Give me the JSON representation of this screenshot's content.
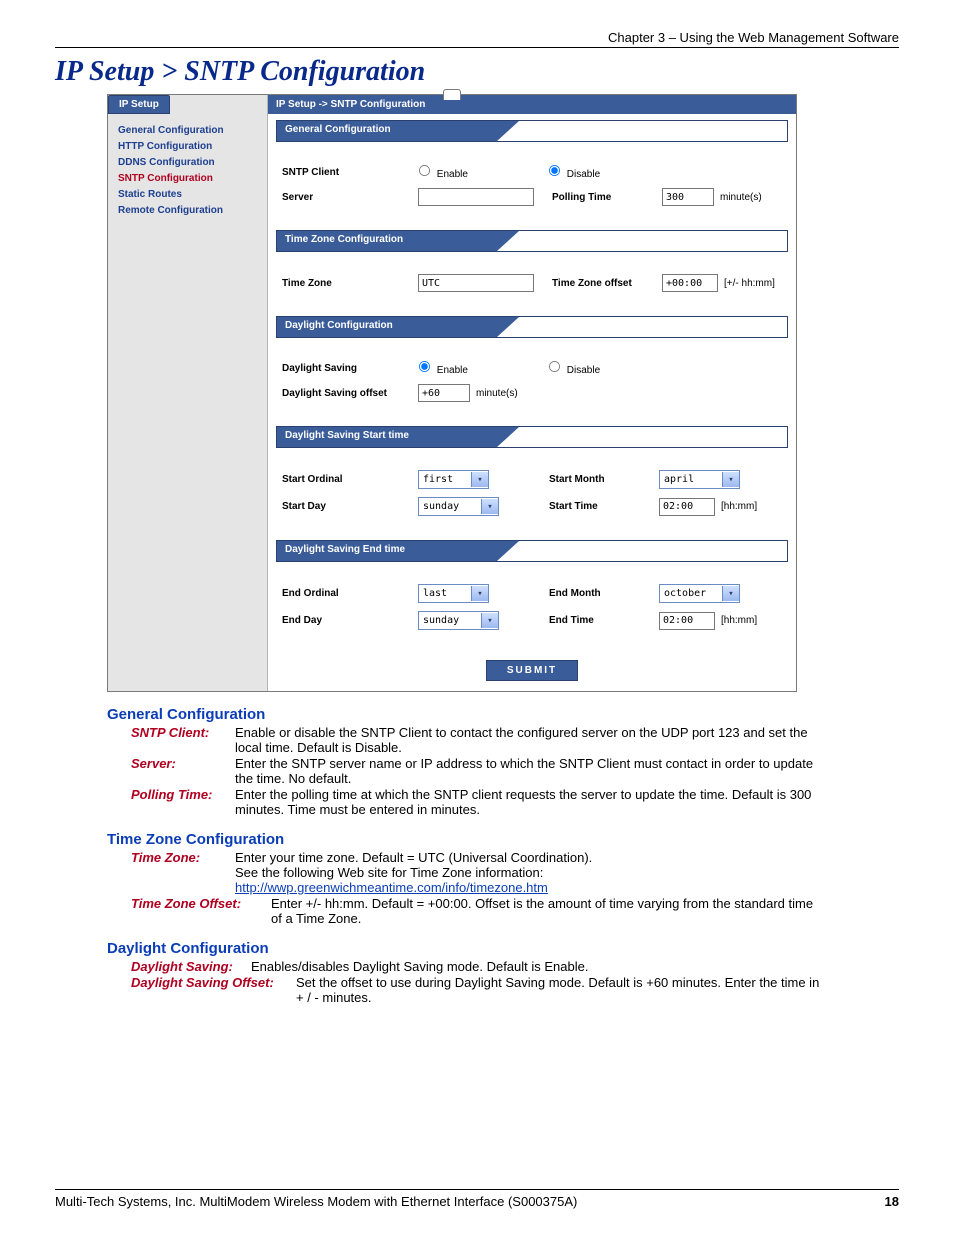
{
  "chapter_head": "Chapter 3 – Using the Web Management Software",
  "page_title": "IP Setup > SNTP Configuration",
  "sidebar": {
    "tab": "IP Setup",
    "items": [
      {
        "label": "General Configuration",
        "active": false
      },
      {
        "label": "HTTP Configuration",
        "active": false
      },
      {
        "label": "DDNS Configuration",
        "active": false
      },
      {
        "label": "SNTP Configuration",
        "active": true
      },
      {
        "label": "Static Routes",
        "active": false
      },
      {
        "label": "Remote Configuration",
        "active": false
      }
    ]
  },
  "crumb": "IP Setup  ->  SNTP Configuration",
  "sections": {
    "general": {
      "title": "General Configuration",
      "sntp_client_label": "SNTP Client",
      "enable": "Enable",
      "disable": "Disable",
      "sntp_selected": "disable",
      "server_label": "Server",
      "server_value": "",
      "polling_label": "Polling Time",
      "polling_value": "300",
      "polling_unit": "minute(s)"
    },
    "timezone": {
      "title": "Time Zone Configuration",
      "tz_label": "Time Zone",
      "tz_value": "UTC",
      "tzo_label": "Time Zone offset",
      "tzo_value": "+00:00",
      "tzo_unit": "[+/- hh:mm]"
    },
    "daylight": {
      "title": "Daylight Configuration",
      "ds_label": "Daylight Saving",
      "enable": "Enable",
      "disable": "Disable",
      "ds_selected": "enable",
      "dso_label": "Daylight Saving offset",
      "dso_value": "+60",
      "dso_unit": "minute(s)"
    },
    "ds_start": {
      "title": "Daylight Saving Start time",
      "ord_label": "Start Ordinal",
      "ord_value": "first",
      "month_label": "Start Month",
      "month_value": "april",
      "day_label": "Start Day",
      "day_value": "sunday",
      "time_label": "Start Time",
      "time_value": "02:00",
      "time_unit": "[hh:mm]"
    },
    "ds_end": {
      "title": "Daylight Saving End time",
      "ord_label": "End Ordinal",
      "ord_value": "last",
      "month_label": "End Month",
      "month_value": "october",
      "day_label": "End Day",
      "day_value": "sunday",
      "time_label": "End Time",
      "time_value": "02:00",
      "time_unit": "[hh:mm]"
    },
    "submit": "SUBMIT"
  },
  "doc": {
    "general": {
      "heading": "General Configuration",
      "sntp_term": "SNTP Client:",
      "sntp_body": "Enable or disable the SNTP Client to contact the configured server on the UDP port 123 and set the local time. Default is Disable.",
      "server_term": "Server:",
      "server_body": "Enter the SNTP server name or IP address to which the SNTP Client must contact in order to update the time. No default.",
      "poll_term": "Polling Time:",
      "poll_body": "Enter the polling time at which the SNTP client requests the server to update the time. Default is 300 minutes. Time must be entered in minutes."
    },
    "tz": {
      "heading": "Time Zone Configuration",
      "tz_term": "Time Zone:",
      "tz_body1": "Enter your time zone. Default = UTC (Universal Coordination).",
      "tz_body2": "See the following Web site for Time Zone information:",
      "tz_link": "http://wwp.greenwichmeantime.com/info/timezone.htm",
      "tzo_term": "Time Zone Offset:",
      "tzo_body": "Enter +/- hh:mm. Default = +00:00. Offset is the amount of time varying from the standard time of a Time Zone."
    },
    "dl": {
      "heading": "Daylight Configuration",
      "ds_term": "Daylight Saving:",
      "ds_body": "Enables/disables Daylight Saving mode. Default is Enable.",
      "dso_term": "Daylight Saving Offset:",
      "dso_body": "Set the offset to use during Daylight Saving mode. Default is +60 minutes. Enter the time in + / - minutes."
    }
  },
  "footer": {
    "left": "Multi-Tech Systems, Inc. MultiModem Wireless Modem with Ethernet Interface (S000375A)",
    "page": "18"
  }
}
